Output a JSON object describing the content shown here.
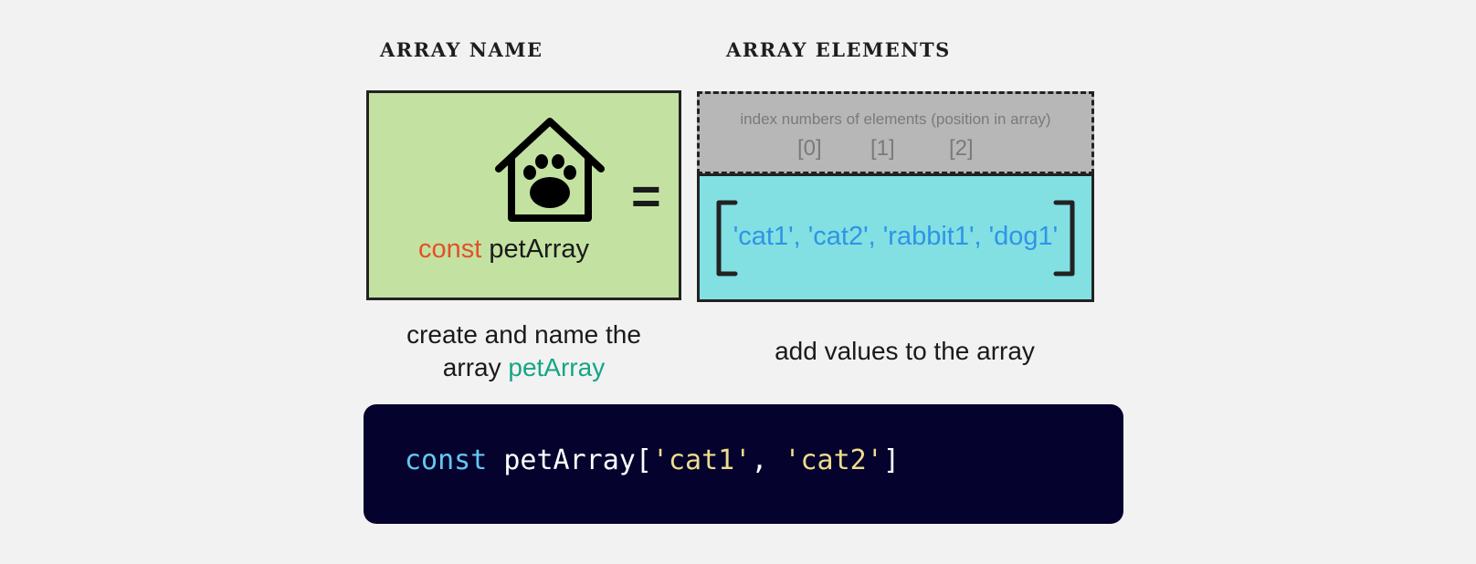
{
  "headings": {
    "array_name": "ARRAY NAME",
    "array_elements": "ARRAY ELEMENTS"
  },
  "name_box": {
    "icon": "dog-house-paw-icon",
    "keyword": "const",
    "name": "petArray",
    "operator": "="
  },
  "index_box": {
    "caption": "index numbers of elements (position in array)",
    "indices": [
      "[0]",
      "[1]",
      "[2]"
    ]
  },
  "values_box": {
    "values_text": "'cat1', 'cat2', 'rabbit1', 'dog1'"
  },
  "captions": {
    "left_line1": "create and name the",
    "left_line2_prefix": "array",
    "left_highlight": "petArray",
    "right": "add values to the array"
  },
  "code": {
    "keyword": "const",
    "identifier": "petArray",
    "open_bracket": "[",
    "string1": "'cat1'",
    "separator": ", ",
    "string2": "'cat2'",
    "close_bracket": "]"
  },
  "colors": {
    "name_box_bg": "#c3e2a1",
    "index_box_bg": "#b7b7b7",
    "values_box_bg": "#82e0e3",
    "values_text": "#2f94e6",
    "keyword_red": "#e3502a",
    "keyword_green": "#16a585",
    "code_bg": "#05022e",
    "code_keyword": "#63c8ef",
    "code_string": "#eddc8c"
  }
}
